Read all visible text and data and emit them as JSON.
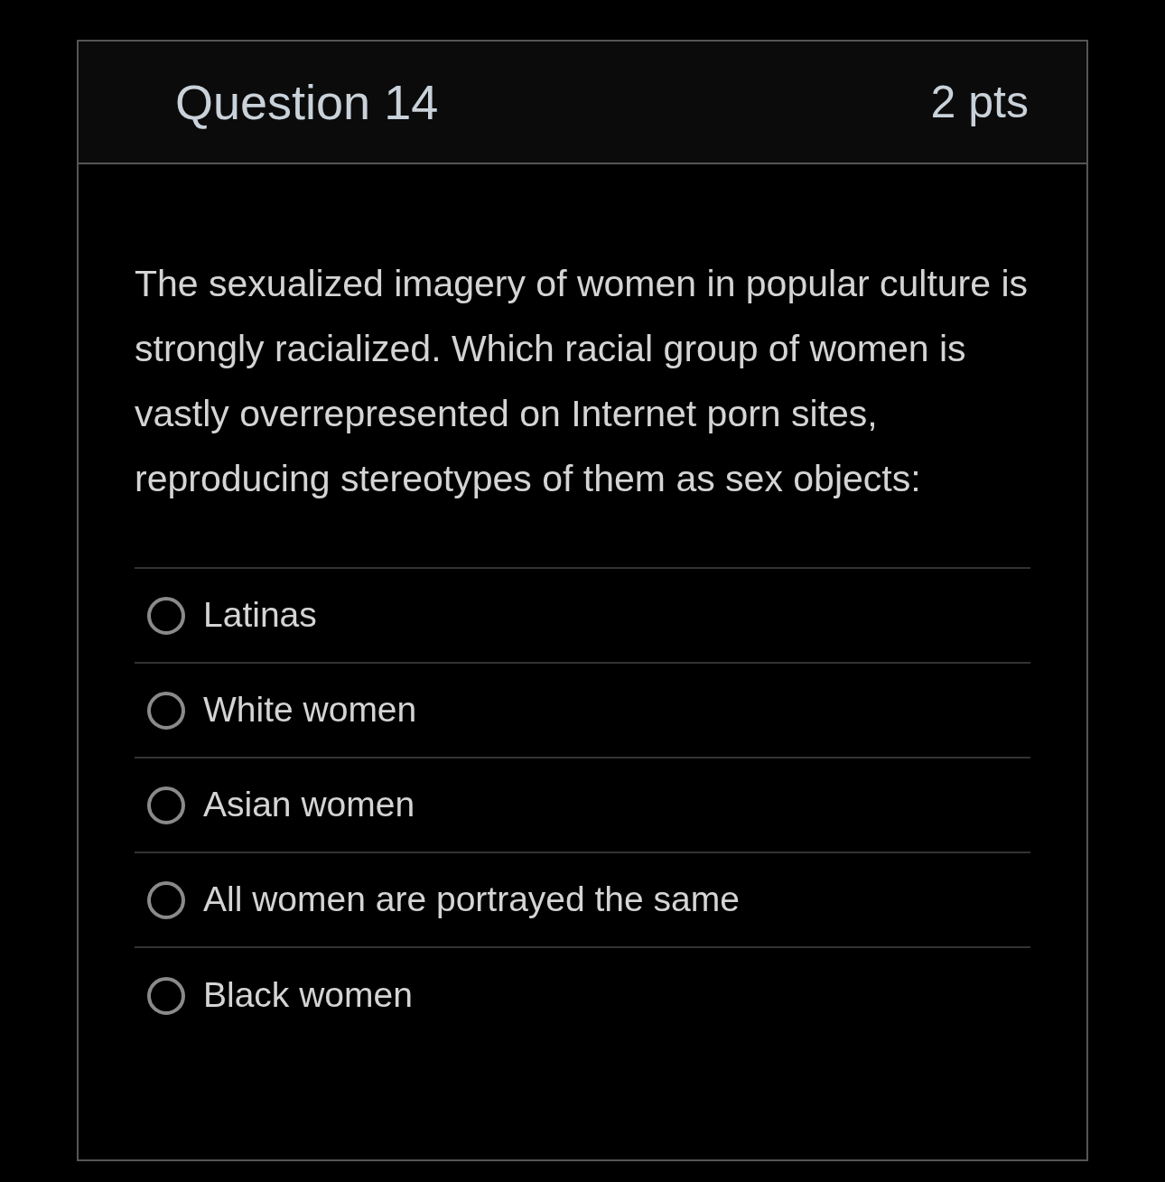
{
  "question": {
    "title": "Question 14",
    "points": "2 pts",
    "text": "The sexualized imagery of women in popular culture is strongly racialized. Which racial group of women is vastly overrepresented on Internet porn sites, reproducing stereotypes of them as sex objects:",
    "options": [
      {
        "label": "Latinas",
        "selected": false
      },
      {
        "label": "White women",
        "selected": false
      },
      {
        "label": "Asian women",
        "selected": false
      },
      {
        "label": "All women are portrayed the same",
        "selected": false
      },
      {
        "label": "Black women",
        "selected": false
      }
    ]
  }
}
